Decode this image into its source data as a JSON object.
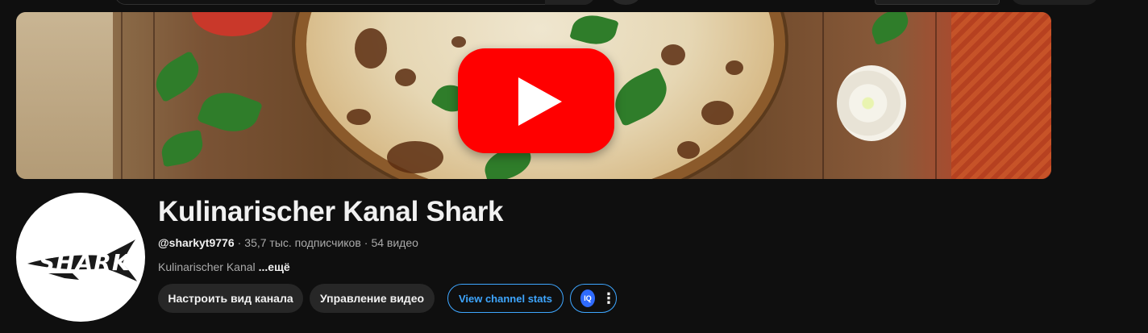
{
  "channel": {
    "name": "Kulinarischer Kanal Shark",
    "handle": "@sharkyt9776",
    "subscribers": "35,7 тыс. подписчиков",
    "videos": "54 видео",
    "description": "Kulinarischer Kanal",
    "more_label": "...ещё",
    "avatar_text": "SHARK"
  },
  "actions": {
    "customize_label": "Настроить вид канала",
    "manage_label": "Управление видео",
    "stats_label": "View channel stats",
    "extension_logo": "IQ",
    "menu_icon": "⋮"
  },
  "colors": {
    "background": "#0f0f0f",
    "accent_blue": "#3ea6ff",
    "youtube_red": "#ff0000",
    "secondary_text": "#aaaaaa"
  },
  "icons": [
    "youtube-play-icon",
    "shark-logo",
    "vidiq-icon",
    "more-vert-icon"
  ]
}
